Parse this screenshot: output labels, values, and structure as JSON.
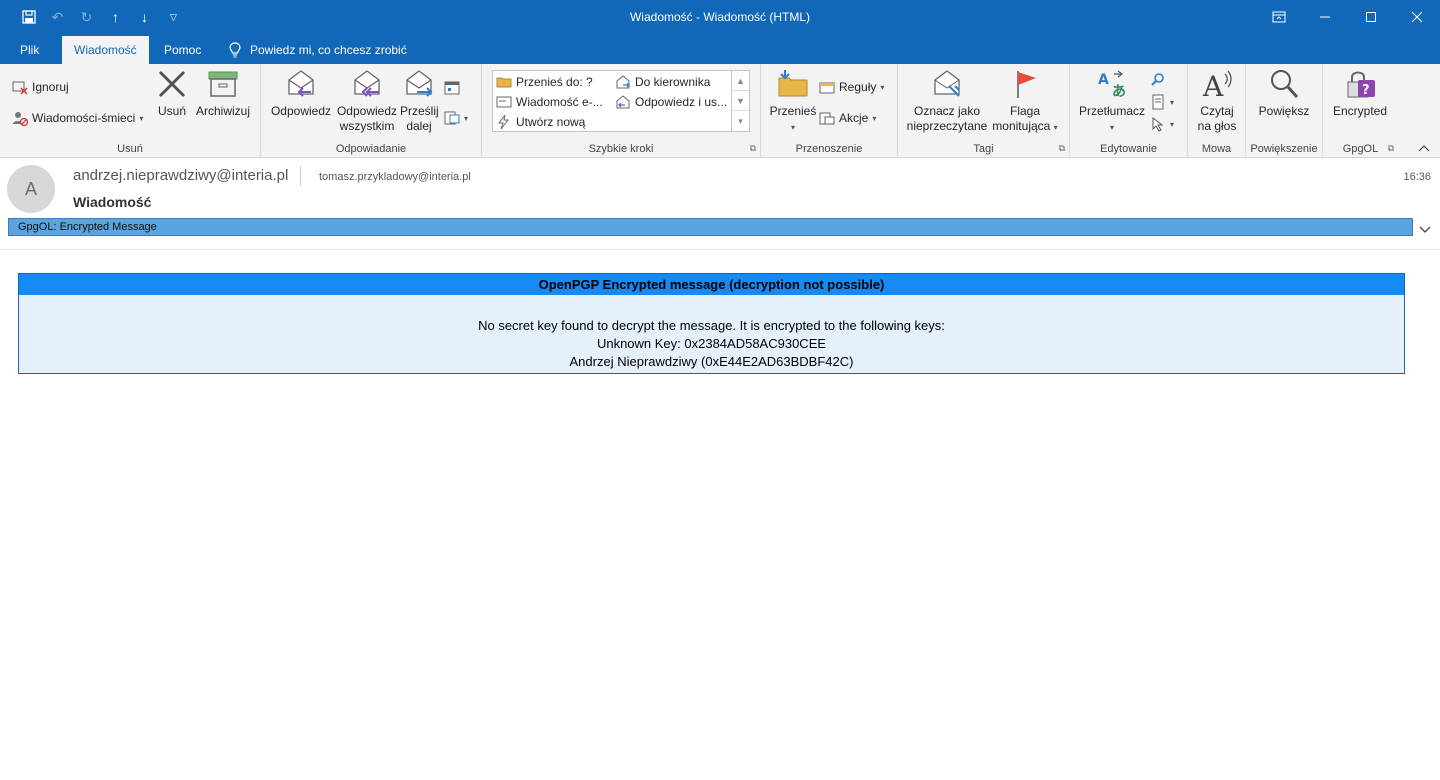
{
  "window": {
    "title": "Wiadomość  -  Wiadomość (HTML)"
  },
  "tabs": [
    {
      "label": "Plik"
    },
    {
      "label": "Wiadomość"
    },
    {
      "label": "Pomoc"
    }
  ],
  "tell_me": "Powiedz mi, co chcesz zrobić",
  "ribbon": {
    "delete_group": {
      "label": "Usuń",
      "ignore": "Ignoruj",
      "junk": "Wiadomości-śmieci",
      "delete": "Usuń",
      "archive": "Archiwizuj"
    },
    "respond_group": {
      "label": "Odpowiadanie",
      "reply": "Odpowiedz",
      "reply_all": "Odpowiedz\nwszystkim",
      "reply_all_line1": "Odpowiedz",
      "reply_all_line2": "wszystkim",
      "forward_line1": "Prześlij",
      "forward_line2": "dalej"
    },
    "quick_steps": {
      "label": "Szybkie kroki",
      "move_to": "Przenieś do: ?",
      "to_manager": "Do kierownika",
      "email": "Wiadomość e-...",
      "reply_delete": "Odpowiedz i us...",
      "create_new": "Utwórz nową"
    },
    "move_group": {
      "label": "Przenoszenie",
      "move": "Przenieś",
      "rules": "Reguły",
      "actions": "Akcje"
    },
    "tags_group": {
      "label": "Tagi",
      "mark_unread_line1": "Oznacz jako",
      "mark_unread_line2": "nieprzeczytane",
      "flag_line1": "Flaga",
      "flag_line2": "monitująca"
    },
    "editing_group": {
      "label": "Edytowanie",
      "translate": "Przetłumacz"
    },
    "speech_group": {
      "label": "Mowa",
      "read_line1": "Czytaj",
      "read_line2": "na głos"
    },
    "zoom_group": {
      "label": "Powiększenie",
      "zoom": "Powiększ"
    },
    "gpgol_group": {
      "label": "GpgOL",
      "encrypted": "Encrypted"
    }
  },
  "message": {
    "avatar_letter": "A",
    "from": "andrzej.nieprawdziwy@interia.pl",
    "to": "tomasz.przykladowy@interia.pl",
    "time": "16:36",
    "subject": "Wiadomość",
    "gpgol_bar": "GpgOL: Encrypted Message"
  },
  "body": {
    "header": "OpenPGP Encrypted message (decryption not possible)",
    "line1": "No secret key found to decrypt the message. It is encrypted to the following keys:",
    "line2": "Unknown Key: 0x2384AD58AC930CEE",
    "line3": "Andrzej Nieprawdziwy (0xE44E2AD63BDBF42C)"
  },
  "colors": {
    "titlebar": "#1168b8",
    "ribbon_bg": "#f3f3f3",
    "gpgol_bar": "#5aa5e0",
    "enc_header": "#1589f4",
    "enc_body": "#e4f0fc"
  }
}
